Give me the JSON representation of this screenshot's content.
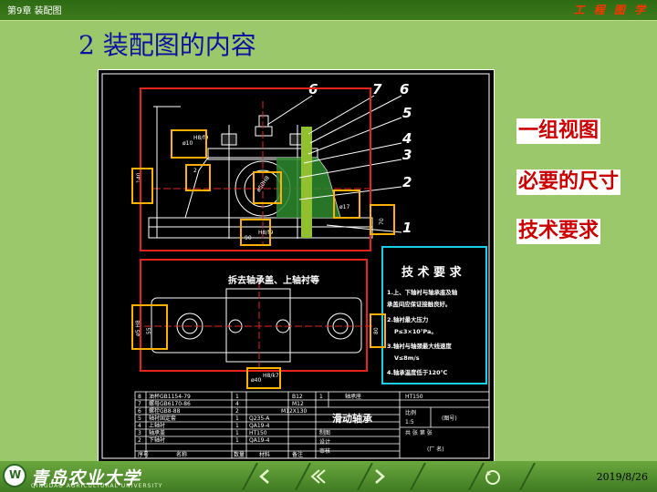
{
  "header": {
    "chapter": "第9章 装配图",
    "brand": "工 程 图 学"
  },
  "title": "2  装配图的内容",
  "drawing": {
    "callouts": [
      "6",
      "7",
      "6",
      "5",
      "4",
      "3",
      "2",
      "1"
    ],
    "dims": {
      "d1": "ø10",
      "d2": "H8/f9",
      "d3": "2",
      "d4": "140",
      "d5": "ø50H8",
      "d6": "ø17",
      "d7": "70",
      "d8": "90",
      "d9": "H8/f9",
      "d10": "ø5 H8",
      "d11": "55",
      "d12": "80",
      "d13": "ø40",
      "d14": "H8/k7"
    },
    "top_view_label": "拆去轴承盖、上轴衬等",
    "notes_title": "技 术 要 求",
    "notes": [
      "1.上、下轴衬与轴承座及轴",
      "承盖间应保证接触良好。",
      "2.轴衬最大压力",
      "P≤3×10⁷Pa。",
      "3.轴衬与轴颈最大线速度",
      "V≤8m/s",
      "4.轴承温度低于120℃"
    ],
    "bom": [
      {
        "no": "8",
        "name": "油杯GB1154-79",
        "qty": "1",
        "mat": "",
        "note": "B12"
      },
      {
        "no": "7",
        "name": "螺母GB6170-86",
        "qty": "4",
        "mat": "",
        "note": "M12"
      },
      {
        "no": "6",
        "name": "螺栓GB8-88",
        "qty": "2",
        "mat": "",
        "note": "M12X130"
      },
      {
        "no": "5",
        "name": "轴衬固定套",
        "qty": "1",
        "mat": "Q235-A",
        "note": ""
      },
      {
        "no": "4",
        "name": "上轴衬",
        "qty": "1",
        "mat": "QA19-4",
        "note": ""
      },
      {
        "no": "3",
        "name": "轴承盖",
        "qty": "1",
        "mat": "HT150",
        "note": ""
      },
      {
        "no": "2",
        "name": "下轴衬",
        "qty": "1",
        "mat": "QA19-4",
        "note": ""
      }
    ],
    "bom_header": {
      "seq": "序号",
      "name": "名称",
      "qty": "数量",
      "mat": "材料",
      "note": "备注"
    },
    "title_block": {
      "part1": "轴承座",
      "part1_mat": "HT150",
      "part1_no": "1",
      "assembly": "滑动轴承",
      "scale_label": "比例",
      "scale": "1:5",
      "drawing_no": "(图号)",
      "draw_label": "制图",
      "design_label": "设计",
      "check_label": "审核",
      "count_label": "数量",
      "weight_label": "重量",
      "total_label": "共 张 第 张",
      "factory": "(厂 名)"
    }
  },
  "tags": [
    "一组视图",
    "必要的尺寸",
    "技术要求"
  ],
  "footer": {
    "university": "青岛农业大学",
    "university_en": "QINGDAO AGRICULTURAL UNIVERSITY",
    "date": "2019/8/26"
  },
  "nav": [
    "prev-icon",
    "back-icon",
    "next-icon",
    "return-icon"
  ],
  "colors": {
    "accent_red": "#cc0000",
    "highlight_orange": "#ffb000",
    "frame_red": "#e8231e",
    "cyan": "#18d0e8",
    "title_blue": "#1010a0"
  }
}
